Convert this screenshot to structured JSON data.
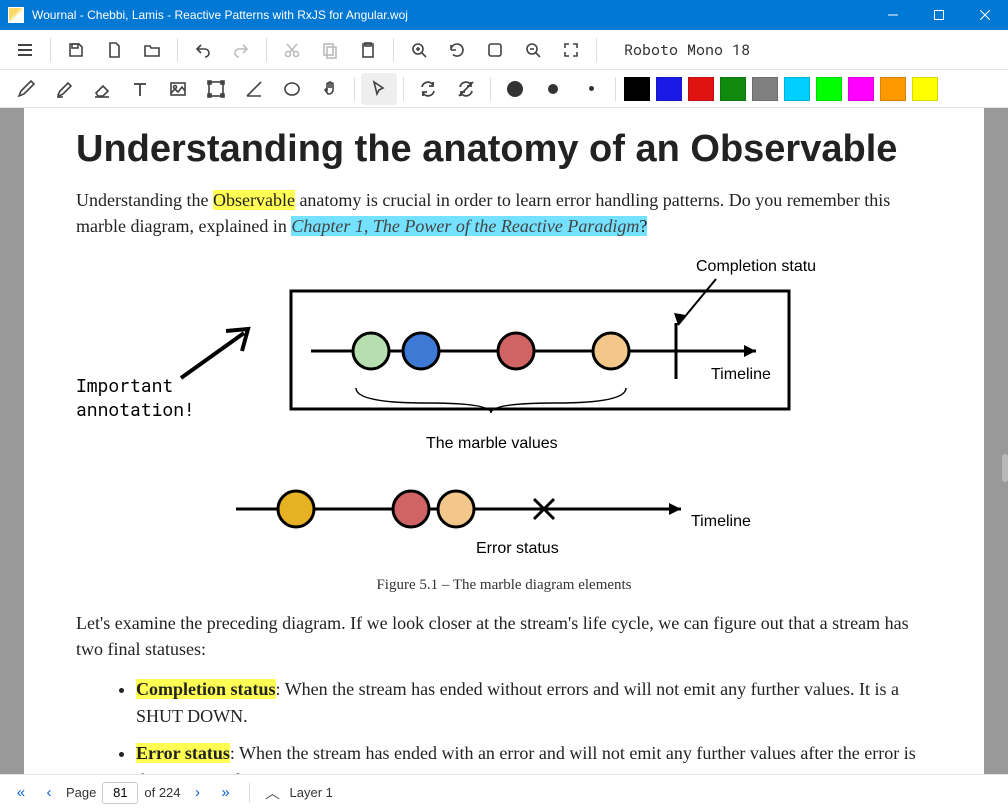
{
  "titlebar": {
    "title": "Wournal - Chebbi, Lamis - Reactive Patterns with RxJS for Angular.woj"
  },
  "toolbar1": {
    "font_label": "Roboto Mono 18"
  },
  "document": {
    "heading": "Understanding the anatomy of an Observable",
    "p1_a": "Understanding the ",
    "p1_hl1": "Observable",
    "p1_b": " anatomy is crucial in order to learn error handling patterns. Do you remember this marble diagram, explained in ",
    "p1_hl2": "Chapter 1, The Power of the Reactive Paradigm",
    "p1_c": "?",
    "annotation_l1": "Important",
    "annotation_l2": "annotation!",
    "diagram1": {
      "completion_label": "Completion status",
      "timeline_label": "Timeline",
      "values_label": "The marble values"
    },
    "diagram2": {
      "timeline_label": "Timeline",
      "error_label": "Error status"
    },
    "figure_caption": "Figure 5.1 – The marble diagram elements",
    "p2": "Let's examine the preceding diagram. If we look closer at the stream's life cycle, we can figure out that a stream has two final statuses:",
    "bullet1_a": "Completion status",
    "bullet1_b": ": When the stream has ended without errors and will not emit any further values. It is a SHUT DOWN.",
    "bullet2_a": "Error status",
    "bullet2_b": ": When the stream has ended with an error and will not emit any further values after the error is thrown. It is also a SHUT DOWN."
  },
  "statusbar": {
    "page_label": "Page",
    "page_current": "81",
    "page_of": "of 224",
    "layer_label": "Layer 1"
  },
  "colors": {
    "black": "#000000",
    "blue": "#1a1ae6",
    "red": "#e01212",
    "green": "#0f8a0f",
    "gray": "#808080",
    "cyan": "#00d0ff",
    "lime": "#00ff00",
    "magenta": "#ff00ff",
    "orange": "#ff9900",
    "yellow": "#ffff00"
  }
}
